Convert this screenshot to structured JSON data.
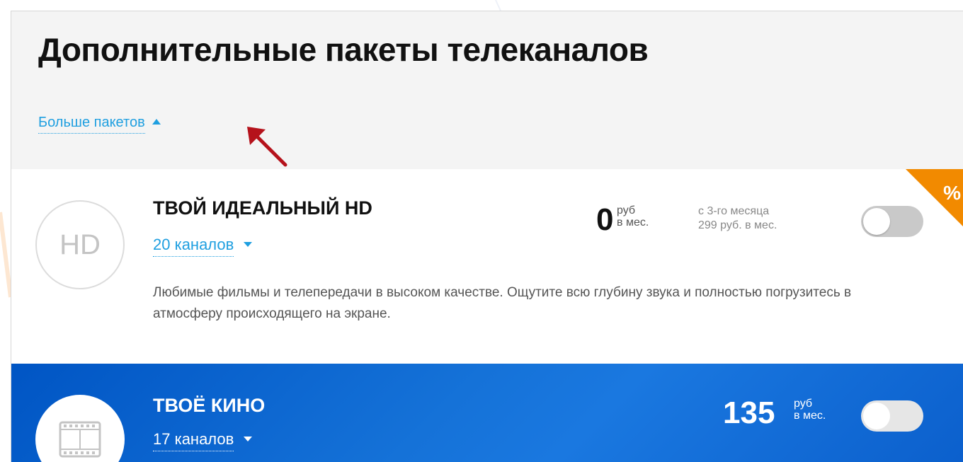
{
  "header": {
    "title": "Дополнительные пакеты телеканалов",
    "more_link": "Больше пакетов"
  },
  "packages": [
    {
      "icon": "hd-icon",
      "icon_text": "HD",
      "title": "ТВОЙ ИДЕАЛЬНЫЙ HD",
      "channels": "20 каналов",
      "price": "0",
      "price_unit_1": "руб",
      "price_unit_2": "в мес.",
      "promo_line_1": "с 3-го месяца",
      "promo_line_2": "299 руб. в мес.",
      "description": "Любимые фильмы и телепередачи в высоком качестве. Ощутите всю глубину звука и полностью погрузитесь в атмосферу происходящего на экране.",
      "promo_badge": "%",
      "enabled": false
    },
    {
      "icon": "film-icon",
      "title": "ТВОЁ КИНО",
      "channels": "17 каналов",
      "price": "135",
      "price_unit_1": "руб",
      "price_unit_2": "в мес.",
      "enabled": false
    }
  ],
  "colors": {
    "accent": "#1f9fe0",
    "promo": "#f28a00",
    "blue_card": "#0b64d4",
    "annotation_arrow": "#b5121b"
  }
}
